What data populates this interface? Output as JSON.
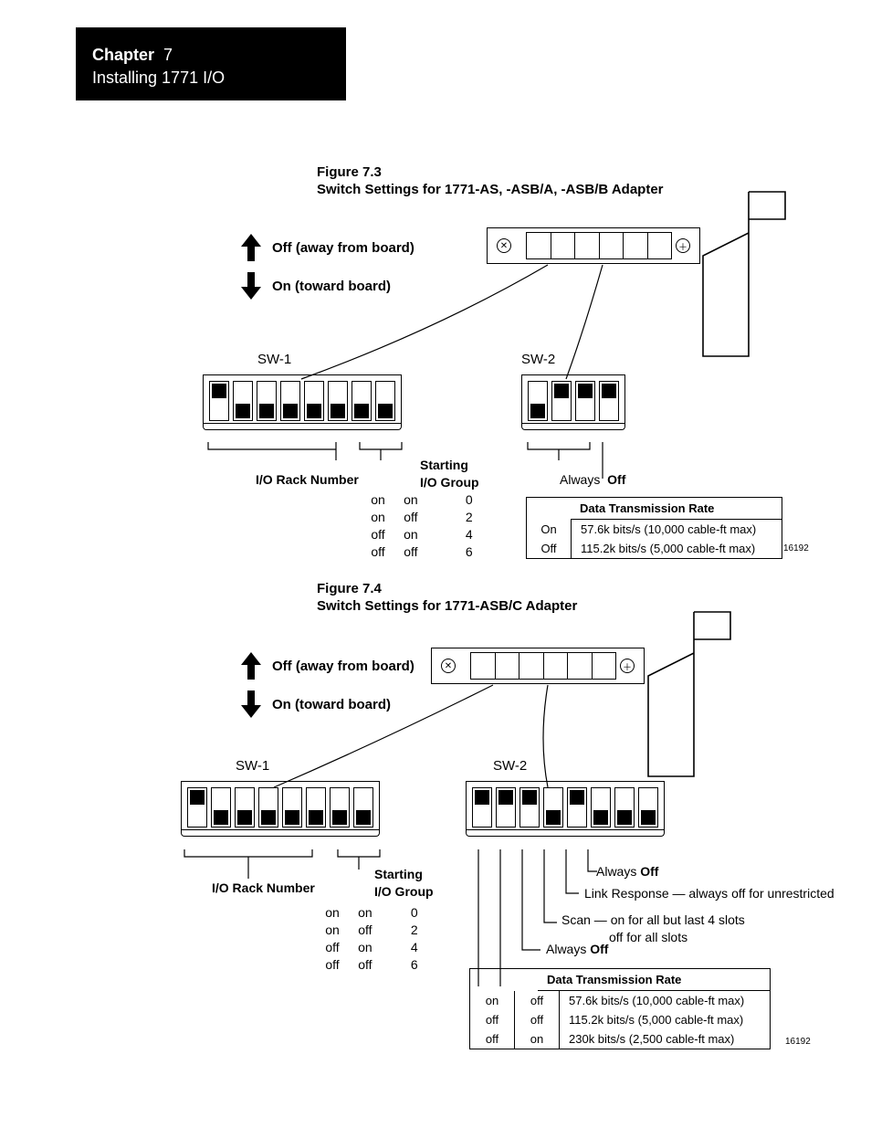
{
  "header": {
    "chapter_label": "Chapter",
    "chapter_number": "7",
    "subtitle": "Installing 1771 I/O"
  },
  "fig73": {
    "num": "Figure 7.3",
    "title": "Switch Settings for 1771-AS, -ASB/A, -ASB/B Adapter"
  },
  "fig74": {
    "num": "Figure 7.4",
    "title": "Switch Settings for 1771-ASB/C Adapter"
  },
  "legend": {
    "off": "Off (away from board)",
    "on": "On (toward board)"
  },
  "labels": {
    "sw1": "SW-1",
    "sw2": "SW-2",
    "io_rack": "I/O Rack Number",
    "start_grp_a": "Starting",
    "start_grp_b": "I/O Group",
    "always": "Always",
    "off": "Off",
    "on": "On",
    "dtr": "Data Transmission Rate",
    "link_resp": "Link Response — always off for unrestricted",
    "scan_a": "Scan — on for all but last 4 slots",
    "scan_b": "off for all slots"
  },
  "start_group": {
    "col1": [
      "on",
      "on",
      "off",
      "off"
    ],
    "col2": [
      "on",
      "off",
      "on",
      "off"
    ],
    "vals": [
      "0",
      "2",
      "4",
      "6"
    ]
  },
  "dtr_73": {
    "rows": [
      {
        "s": "On",
        "txt": "57.6k bits/s (10,000 cable-ft max)"
      },
      {
        "s": "Off",
        "txt": "115.2k bits/s (5,000 cable-ft max)"
      }
    ],
    "ref": "16192"
  },
  "dtr_74": {
    "rows": [
      {
        "s1": "on",
        "s2": "off",
        "txt": "57.6k bits/s (10,000 cable-ft max)"
      },
      {
        "s1": "off",
        "s2": "off",
        "txt": "115.2k bits/s (5,000 cable-ft max)"
      },
      {
        "s1": "off",
        "s2": "on",
        "txt": "230k bits/s (2,500 cable-ft max)"
      }
    ],
    "ref": "16192"
  },
  "dip73_sw1": [
    "up",
    "dn",
    "dn",
    "dn",
    "dn",
    "dn",
    "dn",
    "dn"
  ],
  "dip73_sw2": [
    "dn",
    "up",
    "up",
    "up"
  ],
  "dip74_sw1": [
    "up",
    "dn",
    "dn",
    "dn",
    "dn",
    "dn",
    "dn",
    "dn"
  ],
  "dip74_sw2": [
    "up",
    "up",
    "up",
    "dn",
    "up",
    "dn",
    "dn",
    "dn"
  ]
}
